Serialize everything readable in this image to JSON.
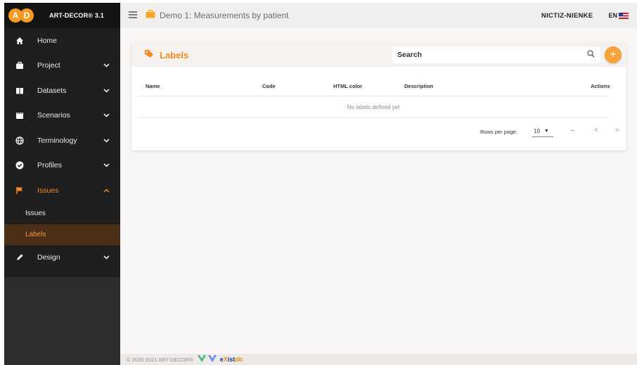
{
  "app": {
    "logo_left": "A",
    "logo_right": "D",
    "name": "ART-DECOR® 3.1"
  },
  "topbar": {
    "title": "Demo 1: Measurements by patient",
    "user": "NICTIZ-NIENKE",
    "lang": "EN"
  },
  "sidebar": {
    "items": [
      {
        "label": "Home",
        "icon": "home-icon"
      },
      {
        "label": "Project",
        "icon": "briefcase-icon"
      },
      {
        "label": "Datasets",
        "icon": "book-icon"
      },
      {
        "label": "Scenarios",
        "icon": "clapperboard-icon"
      },
      {
        "label": "Terminology",
        "icon": "globe-icon"
      },
      {
        "label": "Profiles",
        "icon": "check-circle-icon"
      },
      {
        "label": "Issues",
        "icon": "flag-icon"
      }
    ],
    "sub_items": [
      {
        "label": "Issues"
      },
      {
        "label": "Labels"
      }
    ],
    "design": {
      "label": "Design",
      "icon": "pencil-icon"
    }
  },
  "card": {
    "title": "Labels",
    "search_placeholder": "Search",
    "add_label": "+",
    "columns": [
      "Name",
      "Code",
      "HTML color",
      "Description",
      "Actions"
    ],
    "empty_text": "No labels defined yet",
    "pager": {
      "rows_per_page_label": "Rows per page:",
      "rows_per_page_value": "10",
      "range": "–"
    }
  },
  "footer": {
    "copyright": "© 2020-2021 ART-DECOR®",
    "exist_a": "e",
    "exist_b": "X",
    "exist_c": "ist",
    "exist_d": "db"
  },
  "colors": {
    "accent": "#f08a24",
    "sidebar_bg": "#1f1f1f",
    "selected_bg": "#4a2e16"
  }
}
